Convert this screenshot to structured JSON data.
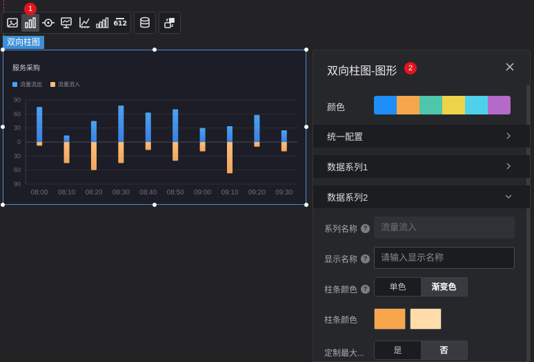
{
  "toolbar": {
    "badge_1": "1",
    "items": [
      {
        "name": "image-icon"
      },
      {
        "name": "bar-chart-icon",
        "active": true
      },
      {
        "name": "target-icon"
      },
      {
        "name": "screen-icon"
      },
      {
        "name": "axis-icon"
      },
      {
        "name": "signal-bars-icon"
      },
      {
        "name": "number-612-icon",
        "text": "612"
      }
    ],
    "data_icon": "database-icon",
    "interaction_icon": "interaction-icon"
  },
  "widget": {
    "tag": "双向柱图",
    "accent": "#4a8ce6"
  },
  "chart_data": {
    "type": "bar",
    "title": "服务采购",
    "categories": [
      "08:00",
      "08:10",
      "08:20",
      "08:30",
      "08:40",
      "08:50",
      "09:00",
      "09:10",
      "09:20",
      "09:30"
    ],
    "series": [
      {
        "name": "流量流出",
        "values": [
          75,
          14,
          45,
          78,
          63,
          70,
          30,
          34,
          58,
          25
        ],
        "color_top": "#4aa3f0",
        "color_bottom": "#3b7fe0"
      },
      {
        "name": "流量流入",
        "values": [
          -8,
          -45,
          -60,
          -45,
          -17,
          -40,
          -20,
          -67,
          -10,
          -20
        ],
        "color_top": "#fbbf7c",
        "color_bottom": "#f5a45c"
      }
    ],
    "y_ticks": [
      "90",
      "60",
      "30",
      "0",
      "30",
      "60",
      "90"
    ],
    "ylim": [
      -90,
      90
    ],
    "legend": "top-left",
    "grid": true
  },
  "panel": {
    "title": "双向柱图-图形",
    "badge_2": "2",
    "color_label": "颜色",
    "palette": [
      "#1e8ff6",
      "#f8a64c",
      "#4ec6ab",
      "#ecd348",
      "#4fd1ec",
      "#b46ac9"
    ],
    "sections": [
      {
        "label": "统一配置",
        "expanded": false
      },
      {
        "label": "数据系列1",
        "expanded": false
      },
      {
        "label": "数据系列2",
        "expanded": true
      }
    ],
    "series_name_label": "系列名称",
    "series_name_value": "流量流入",
    "display_name_label": "显示名称",
    "display_name_placeholder": "请输入显示名称",
    "bar_color_mode_label": "柱条颜色",
    "bar_color_mode_options": [
      "单色",
      "渐变色"
    ],
    "bar_color_mode_selected": "渐变色",
    "bar_color_label": "柱条颜色",
    "bar_colors": [
      "#f8a64c",
      "#ffdcaa"
    ],
    "custom_max_label": "定制最大...",
    "custom_max_options": [
      "是",
      "否"
    ],
    "custom_max_selected": "否"
  }
}
